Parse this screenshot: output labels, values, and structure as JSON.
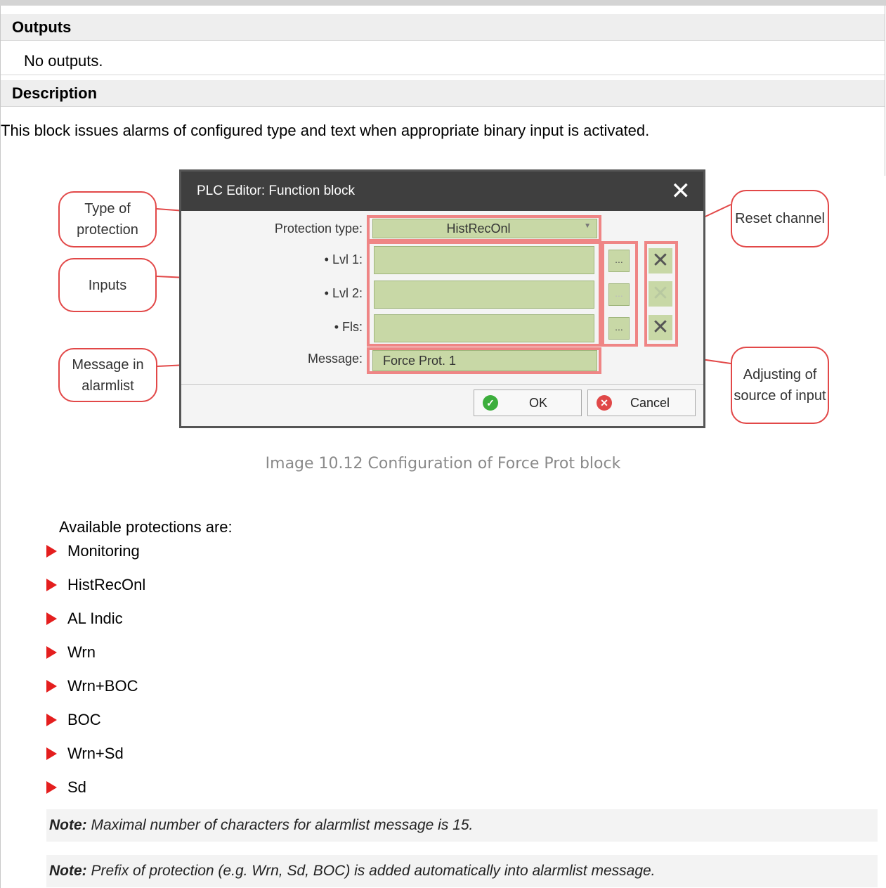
{
  "sections": {
    "outputs_title": "Outputs",
    "outputs_text": "No outputs.",
    "description_title": "Description",
    "description_text": "This block issues alarms of configured type and text when appropriate binary input is activated."
  },
  "figure": {
    "dialog_title": "PLC Editor: Function block",
    "close_symbol": "✕",
    "protection_type_label": "Protection type:",
    "protection_type_value": "HistRecOnl",
    "lvl1_label": "• Lvl 1:",
    "lvl2_label": "• Lvl 2:",
    "fls_label": "• Fls:",
    "message_label": "Message:",
    "message_value": "Force Prot. 1",
    "browse_label": "...",
    "ok_label": "OK",
    "cancel_label": "Cancel",
    "callouts": {
      "type_of_protection": "Type of protection",
      "inputs": "Inputs",
      "message_in_alarmlist": "Message in alarmlist",
      "reset_channel": "Reset channel",
      "adjusting_source": "Adjusting of source of input"
    },
    "caption": "Image 10.12 Configuration of Force Prot block"
  },
  "protections_intro": "Available protections are:",
  "protections": [
    "Monitoring",
    "HistRecOnl",
    "AL Indic",
    "Wrn",
    "Wrn+BOC",
    "BOC",
    "Wrn+Sd",
    "Sd"
  ],
  "notes": [
    {
      "label": "Note:",
      "text": "Maximal number of characters for alarmlist message is 15."
    },
    {
      "label": "Note:",
      "text": "Prefix of protection (e.g. Wrn, Sd, BOC) is added automatically into alarmlist message."
    }
  ],
  "colors": {
    "bullet": "#e41e1e",
    "highlight_box": "#ef8585",
    "field_fill": "#c8d8a6",
    "callout_border": "#e24848"
  }
}
